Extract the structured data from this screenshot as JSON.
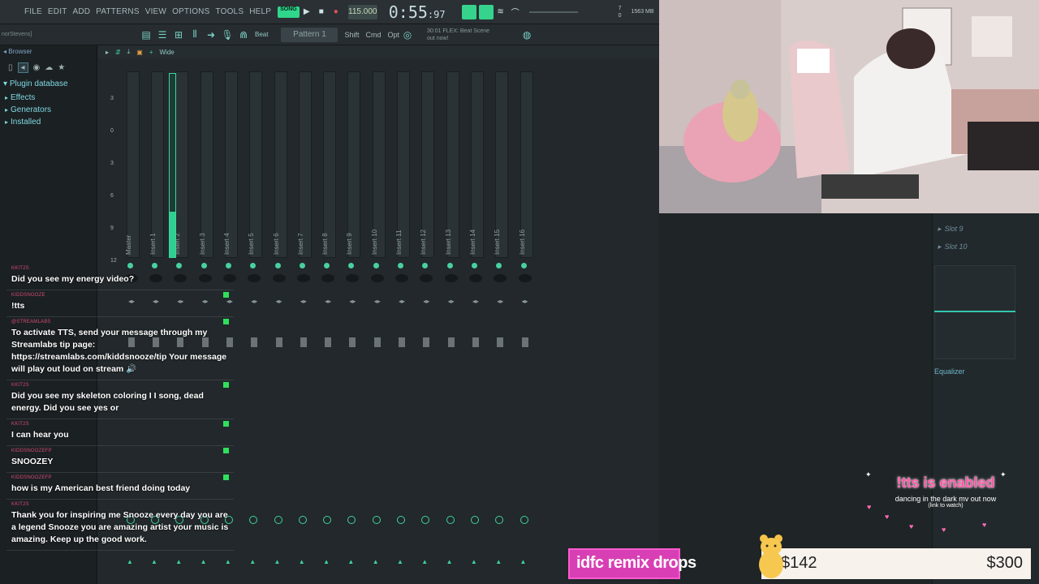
{
  "menu": [
    "FILE",
    "EDIT",
    "ADD",
    "PATTERNS",
    "VIEW",
    "OPTIONS",
    "TOOLS",
    "HELP"
  ],
  "transport": {
    "mode": "SONG",
    "tempo": "115.000",
    "time_main": "0:55",
    "time_sub": ":97",
    "cpu_a": "7",
    "cpu_b": "0",
    "memory": "1563 MB"
  },
  "toolbar": {
    "user_tag": "norStevens]",
    "beat_label": "Beat",
    "pattern": "Pattern 1",
    "shift": "Shift",
    "cmd": "Cmd",
    "opt": "Opt",
    "hint_line1": "30:01  FLEX: Beat Scene",
    "hint_line2": "out now!"
  },
  "browser": {
    "title": "Browser",
    "section": "Plugin database",
    "items": [
      "Effects",
      "Generators",
      "Installed"
    ]
  },
  "mixer": {
    "top_label": "Wide",
    "insert_level": 0.25,
    "scale": [
      "3",
      "0",
      "3",
      "6",
      "9",
      "12"
    ],
    "strips": [
      "Master",
      "Insert 1",
      "Insert 2",
      "Insert 3",
      "Insert 4",
      "Insert 5",
      "Insert 6",
      "Insert 7",
      "Insert 8",
      "Insert 9",
      "Insert 10",
      "Insert 11",
      "Insert 12",
      "Insert 13",
      "Insert 14",
      "Insert 15",
      "Insert 16"
    ]
  },
  "fx_panel": {
    "slots": [
      "Slot 9",
      "Slot 10"
    ],
    "eq_label": "Equalizer"
  },
  "chat": [
    {
      "user": "KKIT2S",
      "text": "Did you see my energy video?",
      "badge": false
    },
    {
      "user": "KIDDSNOOZE",
      "text": "!tts",
      "badge": true
    },
    {
      "user": "@STREAMLABS",
      "text": "To activate TTS, send your message through my Streamlabs tip page: https://streamlabs.com/kiddsnooze/tip Your message will play out loud on stream 🔊",
      "badge": true
    },
    {
      "user": "KKIT2S",
      "text": "Did you see my skeleton coloring I I song, dead energy. Did you see yes or",
      "badge": true
    },
    {
      "user": "KKIT2S",
      "text": "I can hear you",
      "badge": true
    },
    {
      "user": "KIDDSNOOZEFP",
      "text": "SNOOZEY",
      "badge": true
    },
    {
      "user": "KIDDSNOOZEFP",
      "text": "how is my American best friend doing today",
      "badge": true
    },
    {
      "user": "KKIT2S",
      "text": "Thank you for inspiring me Snooze every day you are a legend Snooze you are amazing artist your music is amazing. Keep up the good work.",
      "badge": false
    }
  ],
  "tts_banner": {
    "title": "!tts is enabled",
    "sub1": "dancing in the dark mv out now",
    "sub2": "(link to watch)"
  },
  "goal": {
    "title": "idfc remix drops",
    "current": "$142",
    "target": "$300",
    "progress": 0.473
  },
  "colors": {
    "accent": "#35d38c",
    "chat_user": "#d14b72",
    "goal_pink": "#d93fb5",
    "tts_pink": "#ff5ba8"
  }
}
